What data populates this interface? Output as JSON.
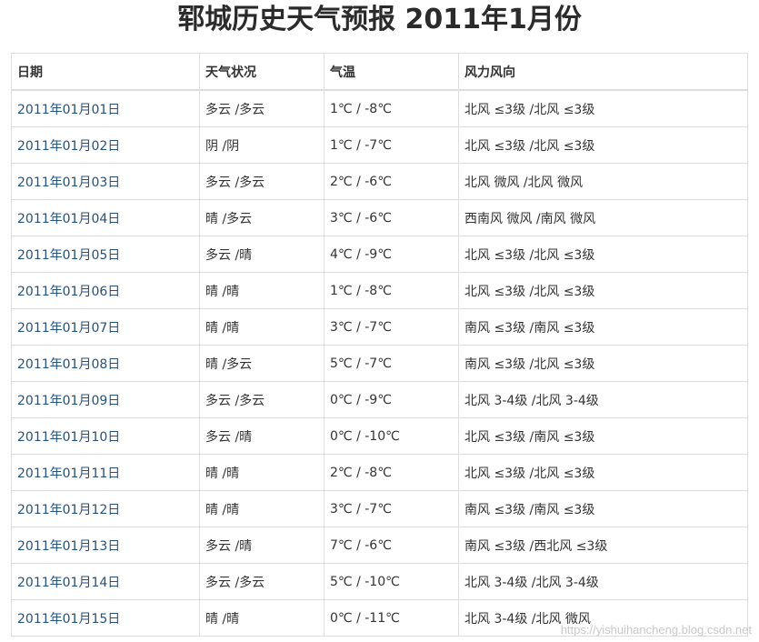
{
  "title": "郓城历史天气预报 2011年1月份",
  "table": {
    "headers": [
      "日期",
      "天气状况",
      "气温",
      "风力风向"
    ],
    "rows": [
      {
        "date": "2011年01月01日",
        "condition": "多云 /多云",
        "temp": "1℃ / -8℃",
        "wind": "北风 ≤3级 /北风 ≤3级"
      },
      {
        "date": "2011年01月02日",
        "condition": "阴 /阴",
        "temp": "1℃ / -7℃",
        "wind": "北风 ≤3级 /北风 ≤3级"
      },
      {
        "date": "2011年01月03日",
        "condition": "多云 /多云",
        "temp": "2℃ / -6℃",
        "wind": "北风 微风 /北风 微风"
      },
      {
        "date": "2011年01月04日",
        "condition": "晴 /多云",
        "temp": "3℃ / -6℃",
        "wind": "西南风 微风 /南风 微风"
      },
      {
        "date": "2011年01月05日",
        "condition": "多云 /晴",
        "temp": "4℃ / -9℃",
        "wind": "北风 ≤3级 /北风 ≤3级"
      },
      {
        "date": "2011年01月06日",
        "condition": "晴 /晴",
        "temp": "1℃ / -8℃",
        "wind": "北风 ≤3级 /北风 ≤3级"
      },
      {
        "date": "2011年01月07日",
        "condition": "晴 /晴",
        "temp": "3℃ / -7℃",
        "wind": "南风 ≤3级 /南风 ≤3级"
      },
      {
        "date": "2011年01月08日",
        "condition": "晴 /多云",
        "temp": "5℃ / -7℃",
        "wind": "南风 ≤3级 /北风 ≤3级"
      },
      {
        "date": "2011年01月09日",
        "condition": "多云 /多云",
        "temp": "0℃ / -9℃",
        "wind": "北风 3-4级 /北风 3-4级"
      },
      {
        "date": "2011年01月10日",
        "condition": "多云 /晴",
        "temp": "0℃ / -10℃",
        "wind": "北风 ≤3级 /南风 ≤3级"
      },
      {
        "date": "2011年01月11日",
        "condition": "晴 /晴",
        "temp": "2℃ / -8℃",
        "wind": "北风 ≤3级 /北风 ≤3级"
      },
      {
        "date": "2011年01月12日",
        "condition": "晴 /晴",
        "temp": "3℃ / -7℃",
        "wind": "南风 ≤3级 /南风 ≤3级"
      },
      {
        "date": "2011年01月13日",
        "condition": "多云 /晴",
        "temp": "7℃ / -6℃",
        "wind": "南风 ≤3级 /西北风 ≤3级"
      },
      {
        "date": "2011年01月14日",
        "condition": "多云 /多云",
        "temp": "5℃ / -10℃",
        "wind": "北风 3-4级 /北风 3-4级"
      },
      {
        "date": "2011年01月15日",
        "condition": "晴 /晴",
        "temp": "0℃ / -11℃",
        "wind": "北风 3-4级 /北风 微风"
      }
    ]
  },
  "watermark": "https://yishuihancheng.blog.csdn.net",
  "colors": {
    "link": "#23527c",
    "border": "#dddddd",
    "text": "#333333"
  }
}
